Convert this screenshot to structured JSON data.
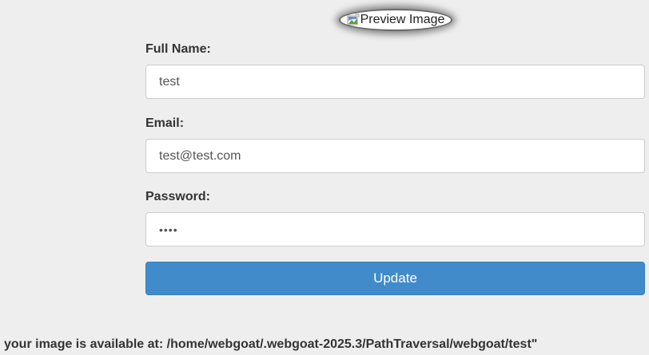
{
  "preview": {
    "alt_text": "Preview Image",
    "icon": "broken-image-icon"
  },
  "form": {
    "full_name": {
      "label": "Full Name:",
      "value": "test"
    },
    "email": {
      "label": "Email:",
      "value": "test@test.com"
    },
    "password": {
      "label": "Password:",
      "value": "test"
    },
    "update_label": "Update"
  },
  "status_message": "your image is available at: /home/webgoat/.webgoat-2025.3/PathTraversal/webgoat/test\"",
  "colors": {
    "page_background": "#eeeeee",
    "button_primary": "#428bca",
    "field_border": "#cccccc",
    "text": "#333333"
  }
}
